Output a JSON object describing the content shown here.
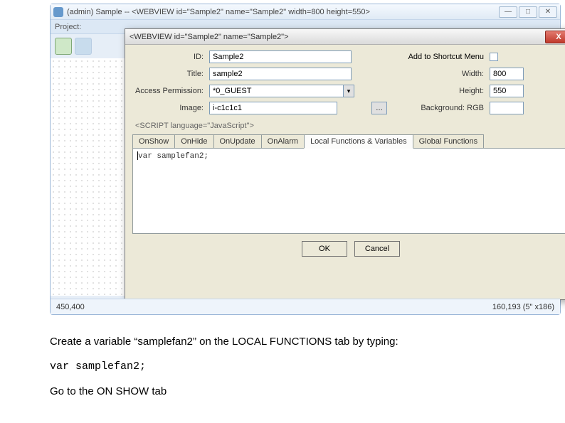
{
  "app": {
    "title_prefix": "(admin) Sample -- ",
    "title_tag": "<WEBVIEW id=\"Sample2\" name=\"Sample2\" width=800 height=550>",
    "project_label": "Project:"
  },
  "dialog": {
    "title": "<WEBVIEW id=\"Sample2\" name=\"Sample2\">",
    "labels": {
      "id": "ID:",
      "title": "Title:",
      "access": "Access Permission:",
      "image": "Image:",
      "shortcut": "Add to Shortcut Menu",
      "width": "Width:",
      "height": "Height:",
      "background": "Background: RGB"
    },
    "values": {
      "id": "Sample2",
      "title": "sample2",
      "access": "*0_GUEST",
      "image": "i-c1c1c1",
      "width": "800",
      "height": "550",
      "background": ""
    },
    "script_section": "<SCRIPT language=\"JavaScript\">",
    "tabs": [
      "OnShow",
      "OnHide",
      "OnUpdate",
      "OnAlarm",
      "Local Functions & Variables",
      "Global Functions"
    ],
    "active_tab": 4,
    "editor_text": "var samplefan2;",
    "footer": {
      "ok": "OK",
      "cancel": "Cancel"
    }
  },
  "statusbar": {
    "left": "450,400",
    "right": "160,193 (5\" x186)"
  },
  "instructions": {
    "line1": "Create a variable “samplefan2” on the LOCAL FUNCTIONS tab by typing:",
    "code": "var samplefan2;",
    "line2": "Go to the ON SHOW tab"
  }
}
